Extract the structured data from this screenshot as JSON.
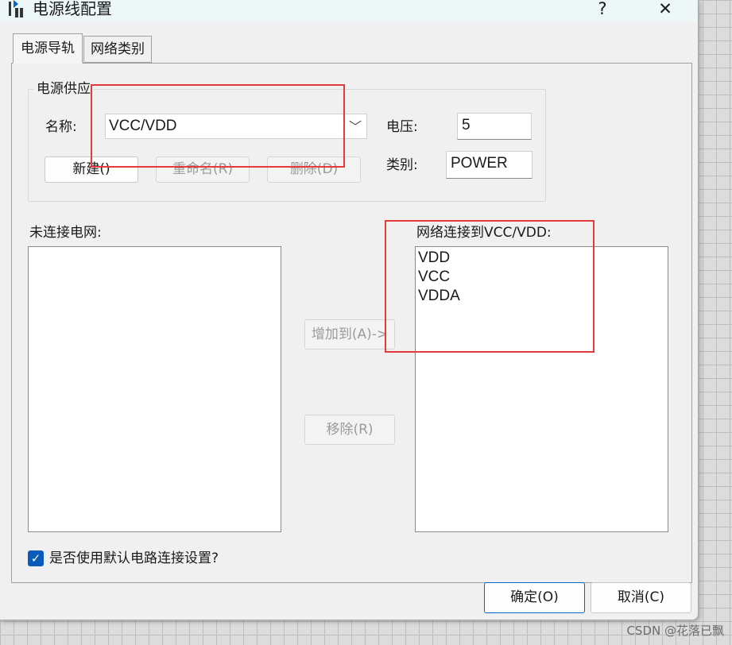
{
  "window": {
    "title": "电源线配置",
    "help_label": "?",
    "close_label": "✕"
  },
  "tabs": [
    {
      "label": "电源导轨",
      "active": true
    },
    {
      "label": "网络类别",
      "active": false
    }
  ],
  "power_supply": {
    "group_label": "电源供应",
    "name_label": "名称:",
    "name_value": "VCC/VDD",
    "voltage_label": "电压:",
    "voltage_value": "5",
    "type_label": "类别:",
    "type_value": "POWER",
    "buttons": {
      "new": "新建()",
      "rename": "重命名(R)",
      "delete": "删除(D)"
    }
  },
  "unconnected": {
    "label": "未连接电网:",
    "items": []
  },
  "connected": {
    "label": "网络连接到VCC/VDD:",
    "items": [
      "VDD",
      "VCC",
      "VDDA"
    ]
  },
  "transfer": {
    "add_label": "增加到(A)->",
    "remove_label": "移除(R)"
  },
  "default_setting": {
    "label": "是否使用默认电路连接设置?",
    "checked": true
  },
  "footer": {
    "ok_label": "确定(O)",
    "cancel_label": "取消(C)"
  },
  "watermark": "CSDN @花落已飘",
  "colors": {
    "highlight_box": "#e5393c",
    "checkbox": "#0b5cba",
    "primary_border": "#0067c0"
  }
}
